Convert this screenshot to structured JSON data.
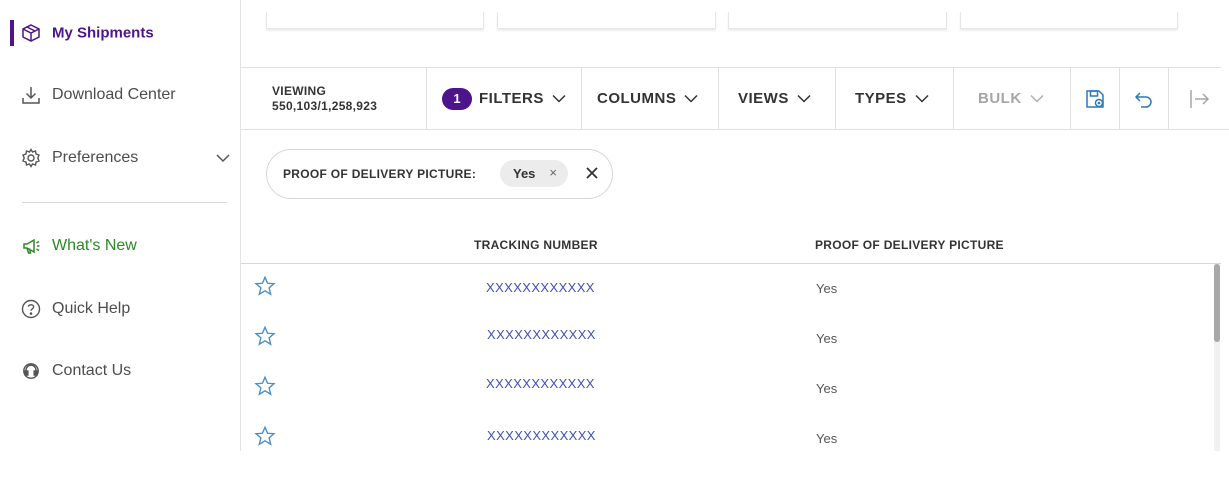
{
  "sidebar": {
    "items": [
      {
        "label": "My Shipments",
        "icon": "package-icon"
      },
      {
        "label": "Download Center",
        "icon": "download-icon"
      },
      {
        "label": "Preferences",
        "icon": "gear-icon"
      },
      {
        "label": "What's New",
        "icon": "megaphone-icon"
      },
      {
        "label": "Quick Help",
        "icon": "question-circle-icon"
      },
      {
        "label": "Contact Us",
        "icon": "headset-icon"
      }
    ]
  },
  "toolbar": {
    "viewing_label": "VIEWING",
    "viewing_count": "550,103/1,258,923",
    "filter_count": "1",
    "filters_label": "FILTERS",
    "columns_label": "COLUMNS",
    "views_label": "VIEWS",
    "types_label": "TYPES",
    "bulk_label": "BULK"
  },
  "active_filter": {
    "label": "PROOF OF DELIVERY PICTURE:",
    "value": "Yes",
    "value_remove": "×"
  },
  "table": {
    "headers": [
      "TRACKING NUMBER",
      "PROOF OF DELIVERY PICTURE"
    ],
    "rows": [
      {
        "tracking": "XXXXXXXXXXXX",
        "pod": "Yes"
      },
      {
        "tracking": "XXXXXXXXXXXX",
        "pod": "Yes"
      },
      {
        "tracking": "XXXXXXXXXXXX",
        "pod": "Yes"
      },
      {
        "tracking": "XXXXXXXXXXXX",
        "pod": "Yes"
      }
    ]
  },
  "colors": {
    "brand_purple": "#4d148c",
    "link_blue": "#3f51b5",
    "green": "#2a8a24",
    "star_blue": "#4a90c8"
  }
}
